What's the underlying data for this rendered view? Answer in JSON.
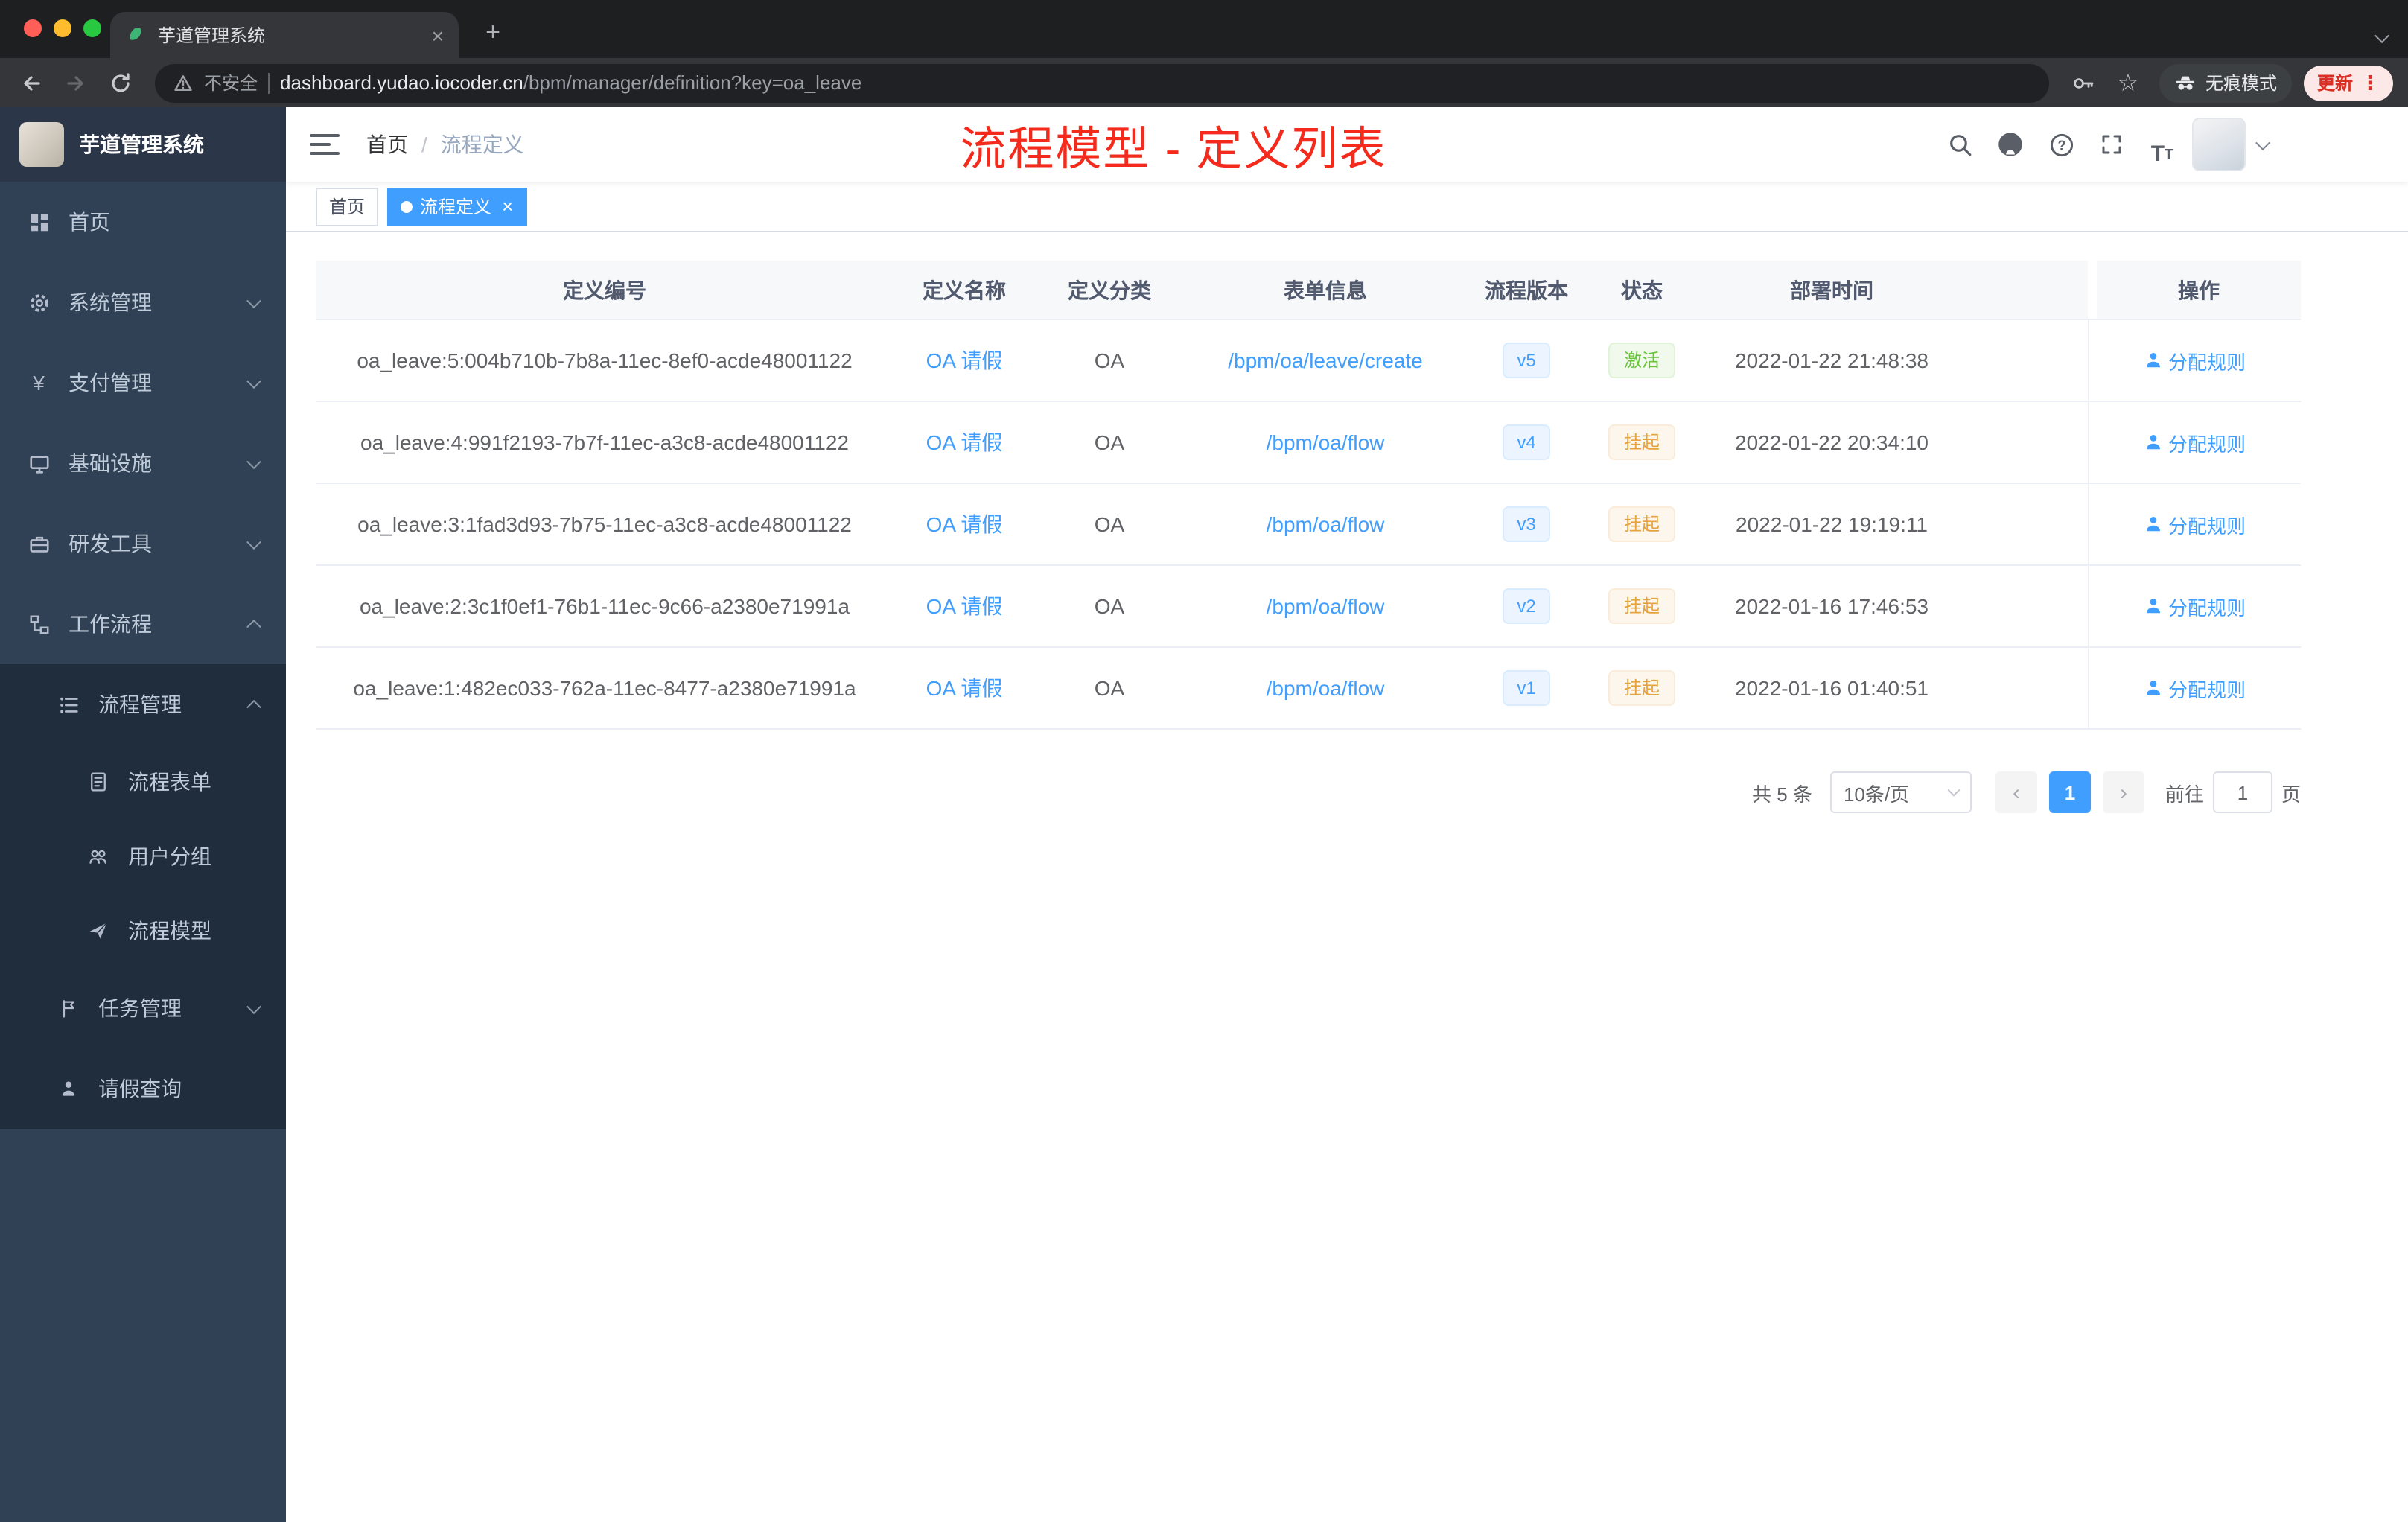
{
  "colors": {
    "accent": "#409eff",
    "annotation_red": "#f42a1d",
    "status_active": "#67c23a",
    "status_suspend": "#e6a23c",
    "sidebar_bg": "#304156",
    "sidebar_sub_bg": "#1f2d3d",
    "tag_active_bg": "#409eff"
  },
  "icons": {
    "close": "×",
    "plus": "+",
    "star": "☆",
    "dots": "⋮",
    "question": "?",
    "text_size": "T",
    "yen": "¥",
    "prev": "‹",
    "next": "›"
  },
  "browser": {
    "tab": {
      "title": "芋道管理系统"
    },
    "address": {
      "security_label": "不安全",
      "domain": "dashboard.yudao.iocoder.cn",
      "path": "/bpm/manager/definition?key=oa_leave"
    },
    "incognito_label": "无痕模式",
    "update_label": "更新"
  },
  "sidebar": {
    "logo_title": "芋道管理系统",
    "items": [
      {
        "label": "首页"
      },
      {
        "label": "系统管理"
      },
      {
        "label": "支付管理"
      },
      {
        "label": "基础设施"
      },
      {
        "label": "研发工具"
      },
      {
        "label": "工作流程"
      },
      {
        "label": "流程管理"
      },
      {
        "label": "流程表单"
      },
      {
        "label": "用户分组"
      },
      {
        "label": "流程模型"
      },
      {
        "label": "任务管理"
      },
      {
        "label": "请假查询"
      }
    ]
  },
  "header": {
    "breadcrumb": {
      "home": "首页",
      "separator": "/",
      "current": "流程定义"
    },
    "annotation": "流程模型 - 定义列表"
  },
  "tags": {
    "home": "首页",
    "active": "流程定义"
  },
  "table": {
    "headers": [
      "定义编号",
      "定义名称",
      "定义分类",
      "表单信息",
      "流程版本",
      "状态",
      "部署时间",
      "操作"
    ],
    "action_label": "分配规则",
    "rows": [
      {
        "id": "oa_leave:5:004b710b-7b8a-11ec-8ef0-acde48001122",
        "name": "OA 请假",
        "category": "OA",
        "form": "/bpm/oa/leave/create",
        "version": "v5",
        "status": "激活",
        "status_type": "success",
        "time": "2022-01-22 21:48:38"
      },
      {
        "id": "oa_leave:4:991f2193-7b7f-11ec-a3c8-acde48001122",
        "name": "OA 请假",
        "category": "OA",
        "form": "/bpm/oa/flow",
        "version": "v4",
        "status": "挂起",
        "status_type": "warning",
        "time": "2022-01-22 20:34:10"
      },
      {
        "id": "oa_leave:3:1fad3d93-7b75-11ec-a3c8-acde48001122",
        "name": "OA 请假",
        "category": "OA",
        "form": "/bpm/oa/flow",
        "version": "v3",
        "status": "挂起",
        "status_type": "warning",
        "time": "2022-01-22 19:19:11"
      },
      {
        "id": "oa_leave:2:3c1f0ef1-76b1-11ec-9c66-a2380e71991a",
        "name": "OA 请假",
        "category": "OA",
        "form": "/bpm/oa/flow",
        "version": "v2",
        "status": "挂起",
        "status_type": "warning",
        "time": "2022-01-16 17:46:53"
      },
      {
        "id": "oa_leave:1:482ec033-762a-11ec-8477-a2380e71991a",
        "name": "OA 请假",
        "category": "OA",
        "form": "/bpm/oa/flow",
        "version": "v1",
        "status": "挂起",
        "status_type": "warning",
        "time": "2022-01-16 01:40:51"
      }
    ]
  },
  "pagination": {
    "total": "共 5 条",
    "page_size": "10条/页",
    "page": "1",
    "goto": "前往",
    "goto_value": "1",
    "page_unit": "页"
  }
}
